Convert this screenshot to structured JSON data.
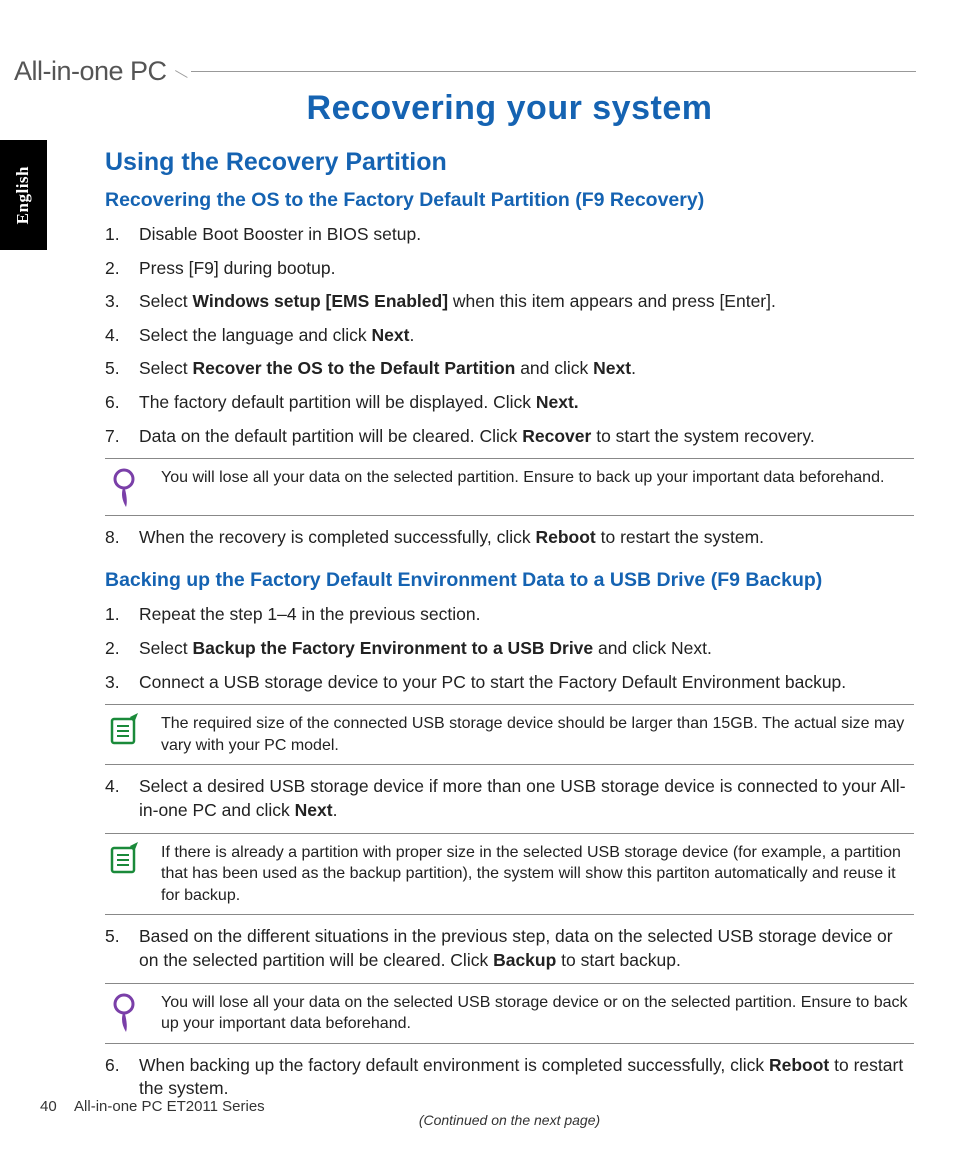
{
  "header": {
    "product": "All-in-one PC"
  },
  "langTab": "English",
  "h1": "Recovering your system",
  "h2": "Using the Recovery Partition",
  "sectionA": {
    "title": "Recovering the OS to the Factory Default Partition (F9 Recovery)",
    "steps": [
      "Disable Boot Booster in BIOS setup.",
      "Press [F9] during bootup.",
      "Select <b>Windows setup [EMS Enabled]</b> when this item appears and press [Enter].",
      "Select the language and click <b>Next</b>.",
      "Select <b>Recover the OS to the Default Partition</b> and click <b>Next</b>.",
      "The factory default partition will be displayed. Click <b>Next.</b>",
      "Data on the default partition will be cleared. Click <b>Recover</b> to start the system recovery."
    ],
    "note1": "You will lose all your data on the selected partition. Ensure to back up your important data beforehand.",
    "step8": "When the recovery is completed successfully, click <b>Reboot</b> to restart the system."
  },
  "sectionB": {
    "title": "Backing up the Factory Default Environment Data to a USB Drive (F9 Backup)",
    "steps1": [
      "Repeat the step 1–4 in the previous section.",
      "Select <b>Backup the Factory Environment to a USB Drive</b> and click Next.",
      "Connect a USB storage device to your PC to start the Factory Default Environment backup."
    ],
    "note1": "The required size of the connected USB storage device should be larger than 15GB. The actual size may vary with your PC model.",
    "step4": "Select a desired USB storage device if more than one USB storage device is connected to your All-in-one PC and click <b>Next</b>.",
    "note2": "If there is already a partition with proper size in the selected USB storage device (for example, a partition that has been used as the backup partition), the system will show this partiton automatically and reuse it for backup.",
    "step5": "Based on the different situations in the previous step, data on the selected USB storage device or on the selected partition will be cleared. Click <b>Backup</b> to start backup.",
    "note3": "You will lose all your data on the selected USB storage device or on the selected partition. Ensure to back up your important data beforehand.",
    "step6": "When backing up the factory default environment is completed successfully, click <b>Reboot</b> to restart the system."
  },
  "continued": "(Continued on the next page)",
  "footer": {
    "page": "40",
    "model": "All-in-one PC ET2011 Series"
  }
}
